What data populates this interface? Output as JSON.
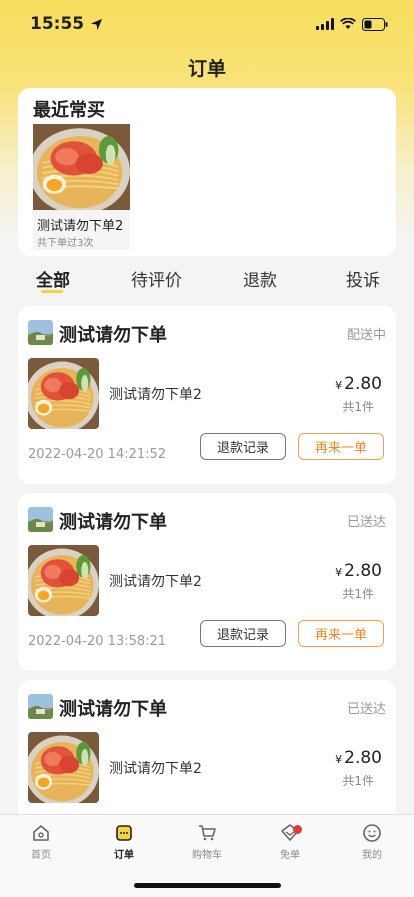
{
  "status": {
    "time": "15:55"
  },
  "nav": {
    "title": "订单"
  },
  "recent": {
    "title": "最近常买",
    "item": {
      "name": "测试请勿下单2",
      "count": "共下单过3次"
    }
  },
  "tabs": [
    {
      "label": "全部"
    },
    {
      "label": "待评价"
    },
    {
      "label": "退款"
    },
    {
      "label": "投诉"
    }
  ],
  "orders": [
    {
      "shop": "测试请勿下单",
      "status": "配送中",
      "product": "测试请勿下单2",
      "currency": "¥",
      "price": "2.80",
      "qty": "共1件",
      "time": "2022-04-20 14:21:52",
      "refund_label": "退款记录",
      "reorder_label": "再来一单"
    },
    {
      "shop": "测试请勿下单",
      "status": "已送达",
      "product": "测试请勿下单2",
      "currency": "¥",
      "price": "2.80",
      "qty": "共1件",
      "time": "2022-04-20 13:58:21",
      "refund_label": "退款记录",
      "reorder_label": "再来一单"
    },
    {
      "shop": "测试请勿下单",
      "status": "已送达",
      "product": "测试请勿下单2",
      "currency": "¥",
      "price": "2.80",
      "qty": "共1件",
      "time": "",
      "refund_label": "",
      "reorder_label": ""
    }
  ],
  "tabbar": [
    {
      "label": "首页",
      "icon": "home-icon"
    },
    {
      "label": "订单",
      "icon": "order-icon"
    },
    {
      "label": "购物车",
      "icon": "cart-icon"
    },
    {
      "label": "免单",
      "icon": "free-order-icon"
    },
    {
      "label": "我的",
      "icon": "profile-icon"
    }
  ],
  "colors": {
    "accent": "#f5d33c",
    "reorder": "#f08a20",
    "badge": "#e53935"
  }
}
